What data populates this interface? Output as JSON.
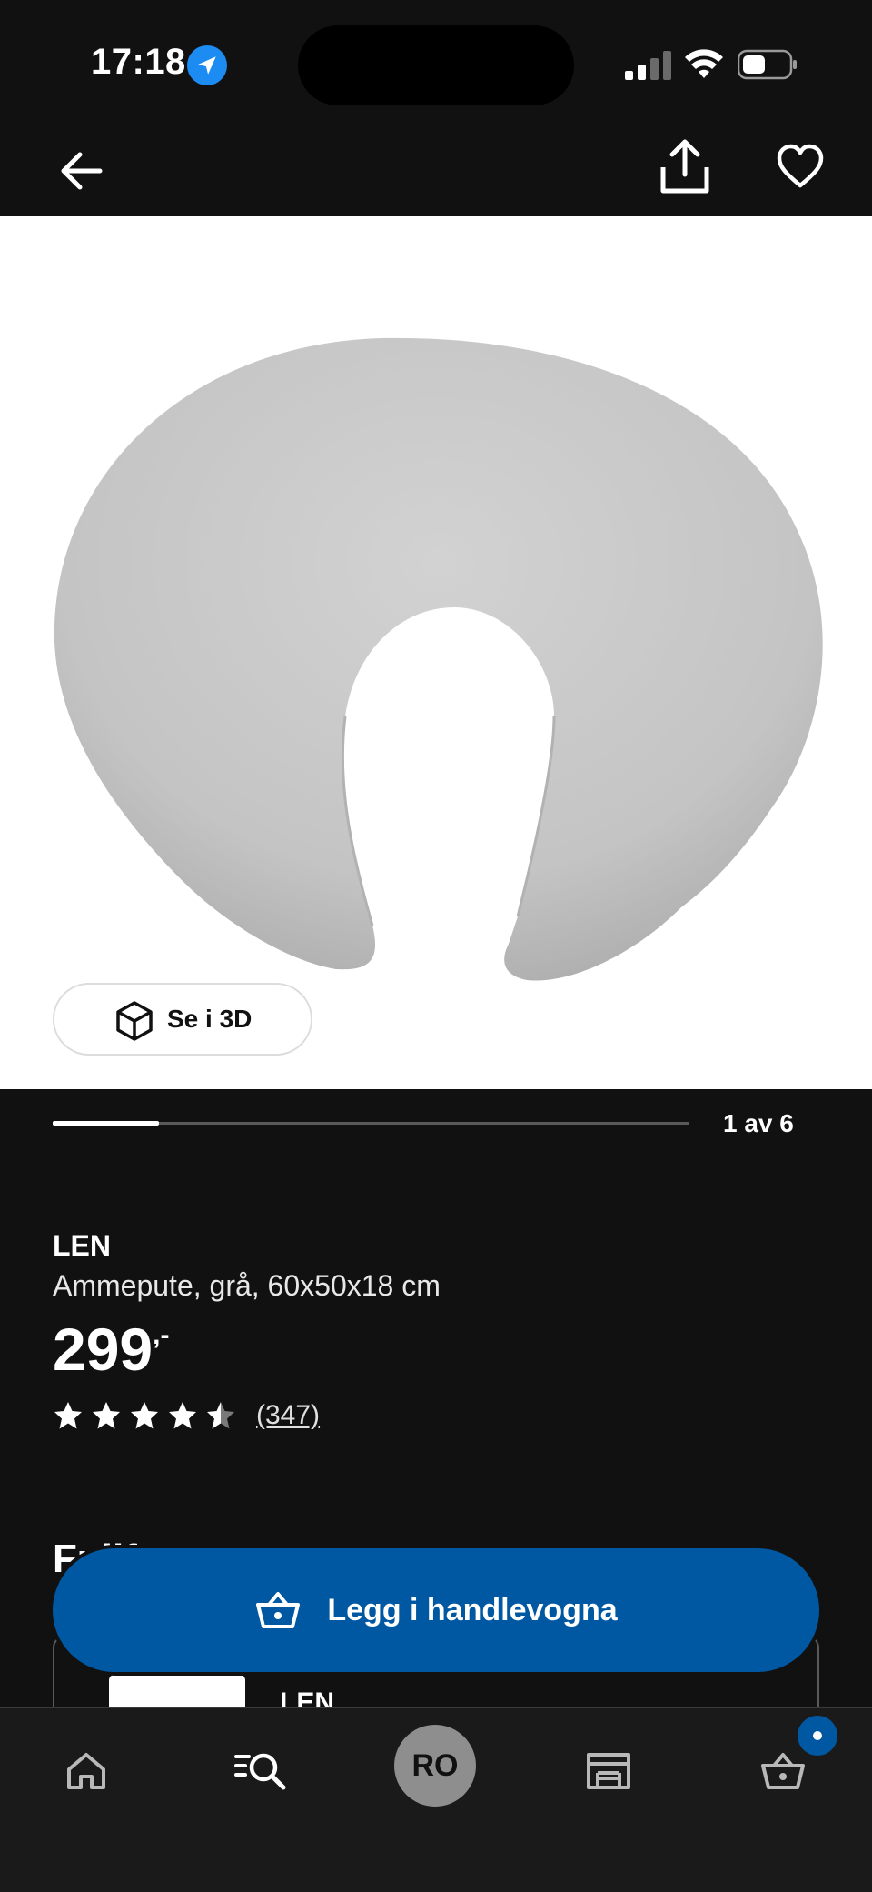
{
  "status_bar": {
    "time": "17:18",
    "icons": [
      "location-arrow-icon",
      "cellular-signal-icon",
      "wifi-icon",
      "battery-icon"
    ]
  },
  "header": {
    "icons": [
      "back-arrow-icon",
      "share-icon",
      "heart-icon"
    ]
  },
  "gallery": {
    "view_3d_label": "Se i 3D",
    "counter": "1 av 6",
    "current_index": 1,
    "total": 6
  },
  "product": {
    "name": "LEN",
    "description": "Ammepute, grå, 60x50x18 cm",
    "price": "299",
    "price_suffix": ",-",
    "rating": 4.5,
    "rating_max": 5,
    "review_count": "(347)"
  },
  "peek": {
    "section_heading": "Fullføre sett",
    "card_title": "LEN"
  },
  "cta": {
    "add_to_cart_label": "Legg i handlevogna"
  },
  "tab_bar": {
    "profile_initials": "RO",
    "tabs": [
      "home-icon",
      "search-icon",
      "profile-avatar",
      "store-icon",
      "cart-icon"
    ]
  },
  "colors": {
    "background": "#111111",
    "brand_blue": "#0058a3",
    "white": "#ffffff",
    "location_blue": "#1c8cf2"
  }
}
